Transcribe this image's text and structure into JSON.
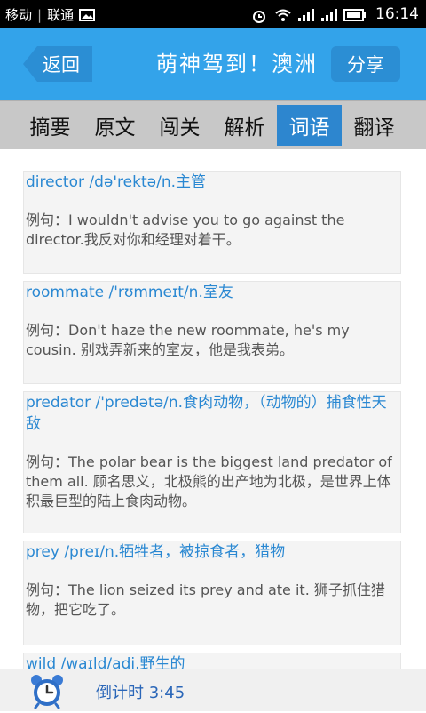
{
  "status_bar": {
    "carrier1": "移动",
    "carrier2": "联通",
    "time": "16:14"
  },
  "header": {
    "back_label": "返回",
    "title": "萌神驾到！澳洲",
    "share_label": "分享"
  },
  "tabs": [
    {
      "label": "摘要"
    },
    {
      "label": "原文"
    },
    {
      "label": "闯关"
    },
    {
      "label": "解析"
    },
    {
      "label": "词语",
      "active": true
    },
    {
      "label": "翻译"
    }
  ],
  "vocab": [
    {
      "word": "director /də'rektə/n.主管",
      "example": "例句：I wouldn't advise you to go against the director.我反对你和经理对着干。"
    },
    {
      "word": "roommate /'rʊmmeɪt/n.室友",
      "example": "例句：Don't haze the new roommate, he's my cousin. 别戏弄新来的室友，他是我表弟。"
    },
    {
      "word": "predator /'predətə/n.食肉动物，（动物的）捕食性天敌",
      "example": "例句：The polar bear is the biggest land predator of them all. 顾名思义，北极熊的出产地为北极，是世界上体积最巨型的陆上食肉动物。"
    },
    {
      "word": "prey /preɪ/n.牺牲者，被掠食者，猎物",
      "example": "例句：The lion seized its prey and ate it. 狮子抓住猎物，把它吃了。"
    },
    {
      "word": "wild /waɪld/adj.野生的",
      "example": ""
    }
  ],
  "footer": {
    "timer_text": "倒计时 3:45"
  },
  "colors": {
    "header_bg": "#33a3ea",
    "accent": "#2d86cf",
    "link": "#2a88d2"
  }
}
